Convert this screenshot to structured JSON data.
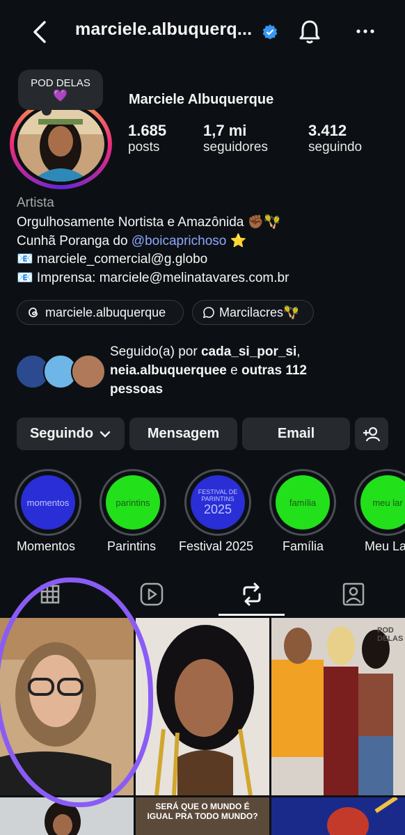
{
  "header": {
    "username": "marciele.albuquerq...",
    "back_icon": "chevron-left-icon",
    "verified_icon": "verified-badge-icon",
    "notify_icon": "bell-icon",
    "more_icon": "more-horizontal-icon"
  },
  "note": {
    "text": "POD DELAS",
    "emoji": "💜"
  },
  "profile": {
    "display_name": "Marciele Albuquerque",
    "stats": [
      {
        "value": "1.685",
        "label": "posts"
      },
      {
        "value": "1,7 mi",
        "label": "seguidores"
      },
      {
        "value": "3.412",
        "label": "seguindo"
      }
    ],
    "category": "Artista",
    "bio": {
      "line1": "Orgulhosamente Nortista e Amazônida ✊🏾🪇",
      "line2_prefix": "Cunhã Poranga do ",
      "line2_link": "@boicaprichoso",
      "line2_suffix": " ⭐",
      "line3": "📧 marciele_comercial@g.globo",
      "line4": "📧 Imprensa: marciele@melinatavares.com.br"
    },
    "chips": [
      {
        "label": "marciele.albuquerque",
        "icon": "threads-icon"
      },
      {
        "label": "Marcilacres🪇",
        "icon": "chat-icon"
      }
    ]
  },
  "followed_by": {
    "prefix": "Seguido(a) por ",
    "names": "cada_si_por_si",
    "sep": ", ",
    "names2": "neia.albuquerquee",
    "mid": " e ",
    "others": "outras 112",
    "end": "pessoas"
  },
  "actions": {
    "following": "Seguindo",
    "message": "Mensagem",
    "email": "Email",
    "add_person_icon": "add-person-icon"
  },
  "highlights": [
    {
      "label": "Momentos",
      "inner": "momentos",
      "color": "#2a2ed6"
    },
    {
      "label": "Parintins",
      "inner": "parintins",
      "color": "#22e01a"
    },
    {
      "label": "Festival 2025",
      "inner": "FESTIVAL DE PARINTINS",
      "inner2": "2025",
      "color": "#2a2ed6"
    },
    {
      "label": "Família",
      "inner": "família",
      "color": "#22e01a"
    },
    {
      "label": "Meu La",
      "inner": "meu lar",
      "color": "#22e01a"
    }
  ],
  "tabs": [
    "grid-icon",
    "reels-icon",
    "reposts-icon",
    "tagged-icon"
  ],
  "posts": [
    {
      "caption": ""
    },
    {
      "caption": ""
    },
    {
      "caption": "POD DELAS"
    },
    {
      "caption": ""
    },
    {
      "caption": "SERÁ QUE O MUNDO É IGUAL PRA TODO MUNDO?"
    },
    {
      "caption": ""
    }
  ]
}
